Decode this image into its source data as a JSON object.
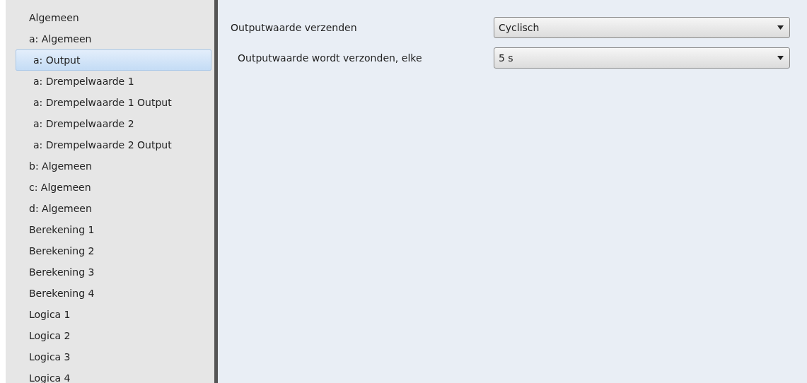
{
  "sidebar": {
    "items": [
      {
        "label": "Algemeen",
        "selected": false
      },
      {
        "label": "a: Algemeen",
        "selected": false,
        "children": [
          {
            "label": "a: Output",
            "selected": true
          },
          {
            "label": "a: Drempelwaarde 1",
            "selected": false
          },
          {
            "label": "a: Drempelwaarde 1 Output",
            "selected": false
          },
          {
            "label": "a: Drempelwaarde 2",
            "selected": false
          },
          {
            "label": "a: Drempelwaarde 2 Output",
            "selected": false
          }
        ]
      },
      {
        "label": "b: Algemeen",
        "selected": false
      },
      {
        "label": "c: Algemeen",
        "selected": false
      },
      {
        "label": "d: Algemeen",
        "selected": false
      },
      {
        "label": "Berekening 1",
        "selected": false
      },
      {
        "label": "Berekening 2",
        "selected": false
      },
      {
        "label": "Berekening 3",
        "selected": false
      },
      {
        "label": "Berekening 4",
        "selected": false
      },
      {
        "label": "Logica 1",
        "selected": false
      },
      {
        "label": "Logica 2",
        "selected": false
      },
      {
        "label": "Logica 3",
        "selected": false
      },
      {
        "label": "Logica 4",
        "selected": false
      }
    ]
  },
  "parameters": [
    {
      "label": "Outputwaarde verzenden",
      "value": "Cyclisch",
      "indented": false
    },
    {
      "label": "Outputwaarde wordt verzonden, elke",
      "value": "5 s",
      "indented": true
    }
  ]
}
